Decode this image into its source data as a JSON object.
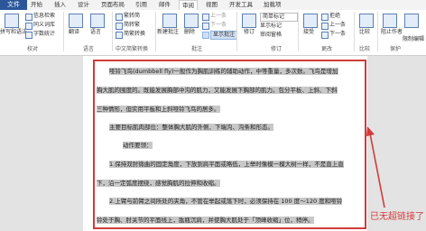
{
  "tabs": [
    {
      "label": "文件"
    },
    {
      "label": "开始"
    },
    {
      "label": "插入"
    },
    {
      "label": "设计"
    },
    {
      "label": "页面布局"
    },
    {
      "label": "引用"
    },
    {
      "label": "邮件"
    },
    {
      "label": "审阅"
    },
    {
      "label": "视图"
    },
    {
      "label": "开发工具"
    },
    {
      "label": "加载项"
    }
  ],
  "ribbon": {
    "proofing": {
      "group_label": "校对",
      "spelling": "拼写和语法",
      "research": "信息检索",
      "thesaurus": "同义词库",
      "word_count": "字数统计"
    },
    "language": {
      "group_label": "语言",
      "translate": "翻译",
      "language": "语言"
    },
    "cn_convert": {
      "group_label": "中文简繁转换",
      "to_trad": "繁转简",
      "to_simp": "简转繁",
      "convert": "简繁转换"
    },
    "comments": {
      "group_label": "批注",
      "new": "新建批注",
      "delete": "删除",
      "prev": "上一条",
      "next": "下一条",
      "show": "显示批注"
    },
    "tracking": {
      "group_label": "修订",
      "track": "修订",
      "markup_select": "简单标记",
      "show_markup": "显示标记",
      "panel": "审阅窗格"
    },
    "changes": {
      "group_label": "更改",
      "accept": "接受",
      "reject": "拒绝",
      "prev": "上一条",
      "next": "下一条"
    },
    "compare": {
      "group_label": "比较",
      "compare": "比较"
    },
    "protect": {
      "group_label": "保护",
      "block": "阻止作者",
      "restrict": "限制编辑"
    }
  },
  "document": {
    "lines": [
      "哑铃飞鸟(dumbbell fly)一般作为胸肌训练的辅助动作，中等重量，多次数。飞鸟是增加",
      "胸大肌的围度的。既能发展胸部中沟的肌力，又能发展下胸部的肌力。包分平板、上斜、下斜",
      "三种情形，但实用平板和上斜哑铃飞鸟的居多。",
      "主要目标肌肉部位：整体胸大肌的外侧、下端沟、沟条和形态。",
      "动作要领：",
      "1.保持双肘微曲的固定角度，下放到肩平面或略低，上举时像模一模大树一样，不是直上直",
      "下，沿一定弧度摆绕，感觉胸肌的拉伸和收缩。",
      "2.上臂与前臂之间所处的夹角，不管在举起或落下时，必须保持在 100 度～120 度和哑铃",
      "铃处于胸、肘关节的平面线上，肱瓶沉肩，并使胸大肌处于「顶峰收缩」位，稍停。"
    ]
  },
  "annotation": "已无超链接了",
  "colors": {
    "accent": "#2b579a",
    "highlight": "#c8c8c8",
    "annotation_red": "#d23b3b"
  }
}
